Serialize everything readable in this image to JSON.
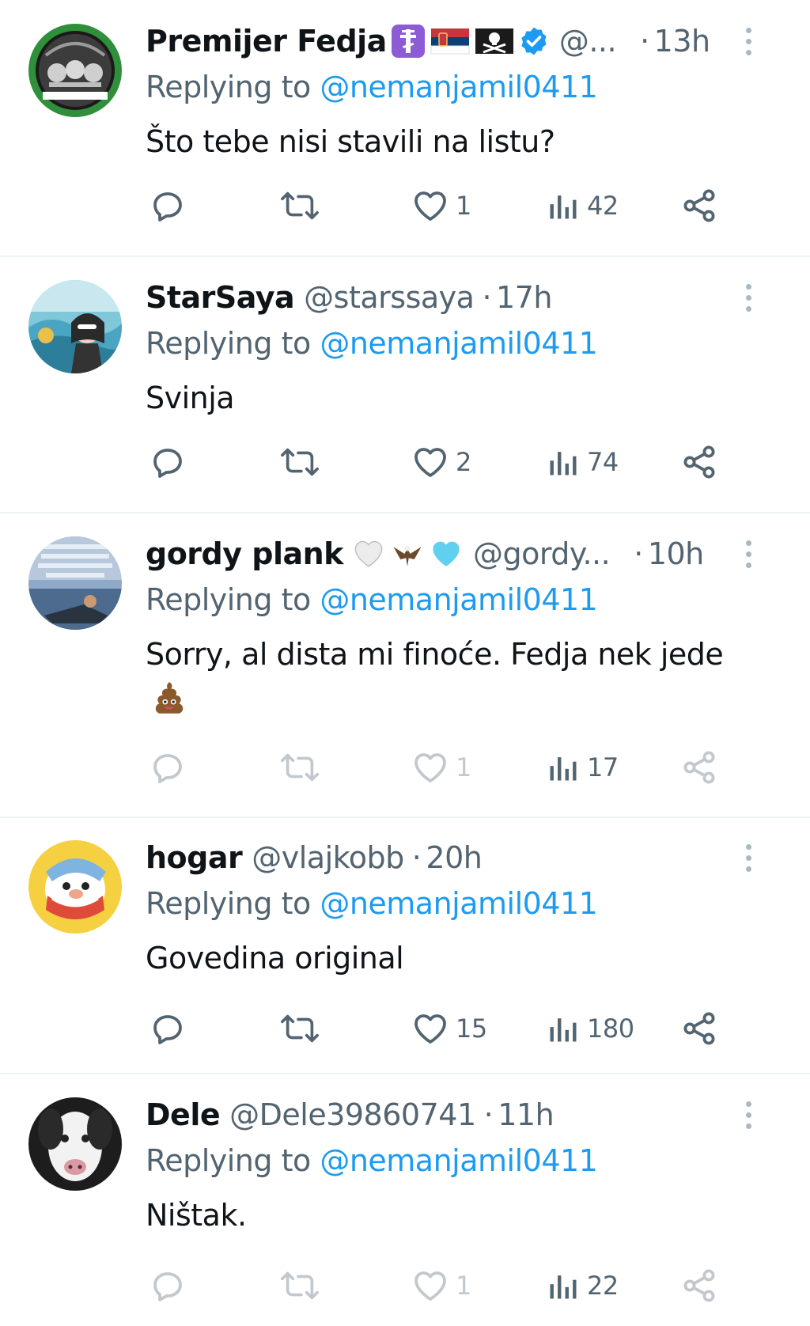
{
  "reply_prefix": "Replying to",
  "colors": {
    "text_primary": "#0f1419",
    "text_secondary": "#536471",
    "link": "#1d9bf0",
    "verified": "#1d9bf0",
    "divider": "#eff3f4"
  },
  "tweets": [
    {
      "name": "Premijer Fedja",
      "name_badges": [
        "orthodox-cross-emoji",
        "serbia-flag-emoji",
        "pirate-flag-emoji",
        "verified-badge-icon"
      ],
      "handle": "@...",
      "separator": "·",
      "time": "13h",
      "mention": "@nemanjamil0411",
      "text": "Što tebe nisi stavili na listu?",
      "text_emoji": "",
      "reply_count": "",
      "retweet_count": "",
      "like_count": "1",
      "view_count": "42",
      "faded": false
    },
    {
      "name": "StarSaya",
      "name_badges": [],
      "handle": "@starssaya",
      "separator": "·",
      "time": "17h",
      "mention": "@nemanjamil0411",
      "text": "Svinja",
      "text_emoji": "",
      "reply_count": "",
      "retweet_count": "",
      "like_count": "2",
      "view_count": "74",
      "faded": false
    },
    {
      "name": "gordy plank",
      "name_badges": [
        "white-heart-emoji",
        "eagle-emoji",
        "light-blue-heart-emoji"
      ],
      "handle": "@gordy...",
      "separator": "·",
      "time": "10h",
      "mention": "@nemanjamil0411",
      "text": "Sorry, al dista mi finoće. Fedja nek jede",
      "text_emoji": "pile-of-poo-emoji",
      "reply_count": "",
      "retweet_count": "",
      "like_count": "1",
      "view_count": "17",
      "faded": true
    },
    {
      "name": "hogar",
      "name_badges": [],
      "handle": "@vlajkobb",
      "separator": "·",
      "time": "20h",
      "mention": "@nemanjamil0411",
      "text": "Govedina original",
      "text_emoji": "",
      "reply_count": "",
      "retweet_count": "",
      "like_count": "15",
      "view_count": "180",
      "faded": false
    },
    {
      "name": "Dele",
      "name_badges": [],
      "handle": "@Dele39860741",
      "separator": "·",
      "time": "11h",
      "mention": "@nemanjamil0411",
      "text": "Ništak.",
      "text_emoji": "",
      "reply_count": "",
      "retweet_count": "",
      "like_count": "1",
      "view_count": "22",
      "faded": true
    }
  ]
}
